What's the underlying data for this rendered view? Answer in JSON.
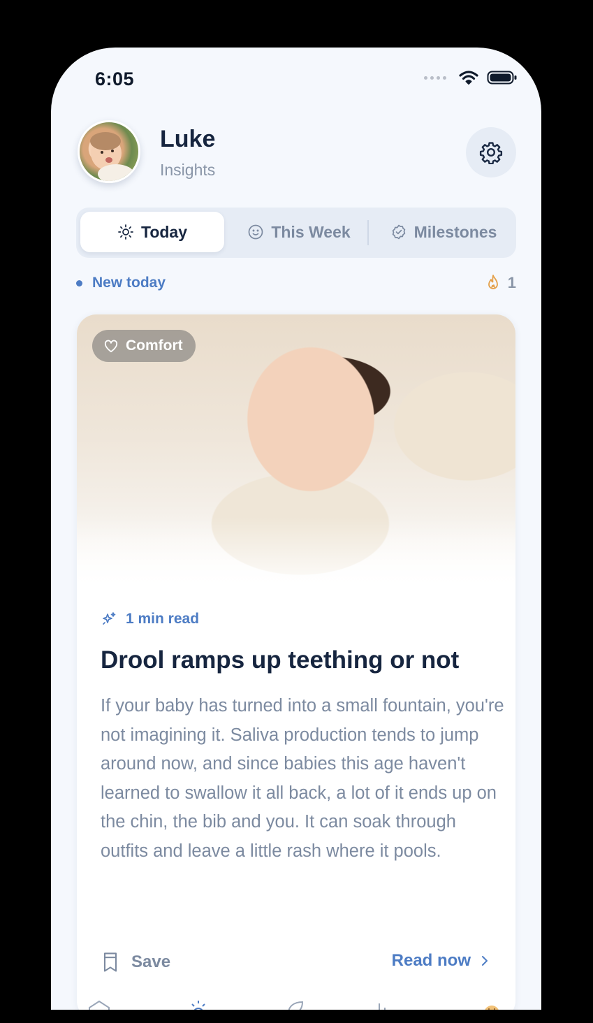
{
  "status": {
    "time": "6:05"
  },
  "header": {
    "name": "Luke",
    "subtitle": "Insights"
  },
  "tabs": [
    {
      "label": "Today",
      "icon": "sun-icon",
      "active": true
    },
    {
      "label": "This Week",
      "icon": "smiley-icon",
      "active": false
    },
    {
      "label": "Milestones",
      "icon": "badge-check-icon",
      "active": false
    }
  ],
  "feed": {
    "new_label": "New today",
    "streak_count": "1"
  },
  "card": {
    "badge": "Comfort",
    "read_time": "1 min read",
    "title": "Drool ramps up teething or not",
    "body": "If your baby has turned into a small fountain, you're not imagining it. Saliva production tends to jump around now, and since babies this age haven't learned to swallow it all back, a lot of it ends up on the chin, the bib and you. It can soak through outfits and leave a little rash where it pools.",
    "save_label": "Save",
    "read_label": "Read now"
  },
  "nav": [
    "home-icon",
    "insights-sun-icon",
    "leaf-icon",
    "stats-icon",
    "baby-face-icon"
  ],
  "colors": {
    "accent": "#4d7cc4",
    "title": "#16253f",
    "muted": "#7c8aa0",
    "background": "#f5f8fd",
    "streak_flame": "#e4a04a"
  }
}
